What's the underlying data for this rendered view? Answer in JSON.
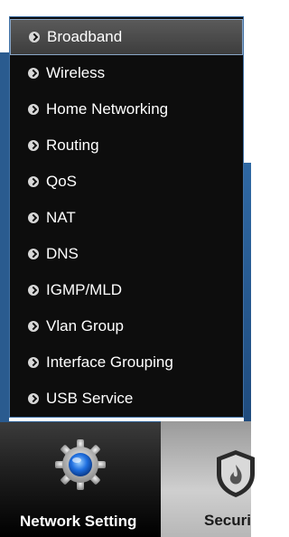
{
  "menu": {
    "items": [
      {
        "label": "Broadband",
        "active": true
      },
      {
        "label": "Wireless"
      },
      {
        "label": "Home Networking"
      },
      {
        "label": "Routing"
      },
      {
        "label": "QoS"
      },
      {
        "label": "NAT"
      },
      {
        "label": "DNS"
      },
      {
        "label": "IGMP/MLD"
      },
      {
        "label": "Vlan Group"
      },
      {
        "label": "Interface Grouping"
      },
      {
        "label": "USB Service"
      }
    ]
  },
  "tabs": {
    "network": {
      "label": "Network Setting",
      "icon": "gear-icon"
    },
    "security": {
      "label": "Securi",
      "icon": "shield-icon"
    }
  },
  "colors": {
    "menu_bg": "#0d0d0d",
    "accent_blue": "#2a5b8f",
    "menu_text": "#ffffff"
  }
}
